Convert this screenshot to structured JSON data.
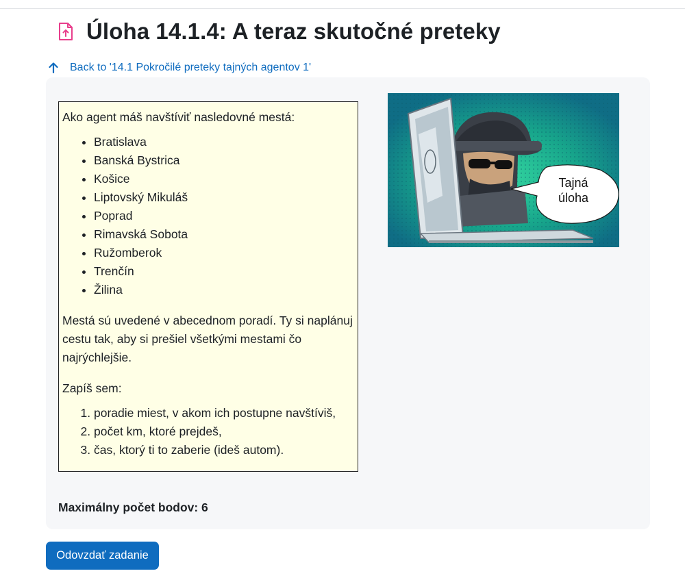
{
  "page": {
    "title": "Úloha 14.1.4: A teraz skutočné preteky",
    "title_icon": "assignment-upload-icon",
    "back_link": "Back to '14.1 Pokročilé preteky tajných agentov 1'",
    "back_icon": "arrow-up-icon"
  },
  "task": {
    "intro": "Ako agent máš navštíviť nasledovné mestá:",
    "cities": [
      "Bratislava",
      "Banská Bystrica",
      "Košice",
      "Liptovský Mikuláš",
      "Poprad",
      "Rimavská Sobota",
      "Ružomberok",
      "Trenčín",
      "Žilina"
    ],
    "paragraph": "Mestá sú uvedené v abecednom poradí. Ty si naplánuj cestu tak, aby si prešiel všetkými mestami čo najrýchlejšie.",
    "write_here": "Zapíš sem:",
    "steps": [
      "poradie miest, v akom ich postupne navštíviš,",
      "počet km, ktoré prejdeš,",
      "čas, ktorý ti to zaberie (ideš autom)."
    ]
  },
  "image": {
    "bubble_line1": "Tajná",
    "bubble_line2": "úloha"
  },
  "max_points": "Maximálny počet bodov: 6",
  "submit_label": "Odovzdať zadanie",
  "colors": {
    "link": "#0f6cbf",
    "button": "#0f6cbf",
    "task_background": "#ffffe6",
    "panel_background": "#f6f7f9",
    "title_icon": "#e83e8c"
  }
}
